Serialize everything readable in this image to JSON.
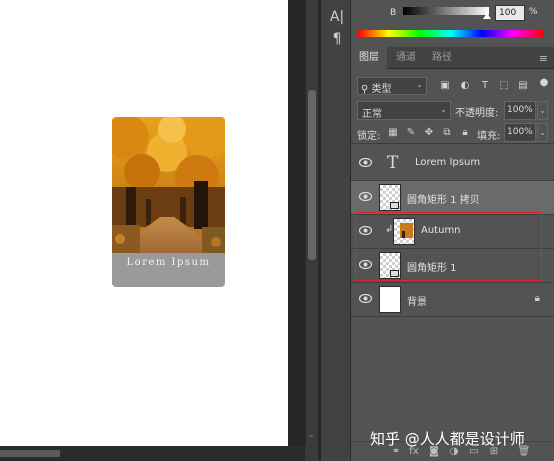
{
  "canvas": {
    "card_caption": "Lorem Ipsum"
  },
  "tools": {
    "items": [
      "A|",
      "¶"
    ]
  },
  "color": {
    "channel_label": "B",
    "value": "100",
    "unit": "%"
  },
  "tabs": [
    "图层",
    "通道",
    "路径"
  ],
  "filter": {
    "kind_label": "类型",
    "icons": [
      "image-filter-icon",
      "adjustment-filter-icon",
      "type-filter-icon",
      "shape-filter-icon",
      "smart-object-filter-icon"
    ]
  },
  "blend": {
    "mode": "正常",
    "opacity_label": "不透明度:",
    "opacity_value": "100%"
  },
  "lock": {
    "label": "锁定:",
    "fill_label": "填充:",
    "fill_value": "100%"
  },
  "layers": [
    {
      "name": "Lorem Ipsum",
      "type": "text",
      "visible": true,
      "selected": false
    },
    {
      "name": "圆角矩形 1 拷贝",
      "type": "shape",
      "visible": true,
      "selected": true
    },
    {
      "name": "Autumn",
      "type": "image-clipped",
      "visible": true,
      "selected": false
    },
    {
      "name": "圆角矩形 1",
      "type": "shape",
      "visible": true,
      "selected": false
    },
    {
      "name": "背景",
      "type": "background",
      "visible": true,
      "selected": false
    }
  ],
  "footer": {
    "buttons": [
      "link-icon",
      "fx-icon",
      "mask-icon",
      "adjustment-icon",
      "group-icon",
      "new-layer-icon",
      "trash-icon"
    ]
  },
  "watermark": "知乎 @人人都是设计师"
}
